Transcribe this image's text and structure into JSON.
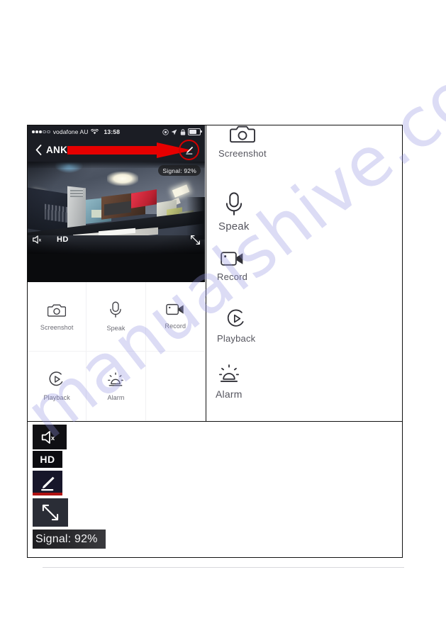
{
  "document": {
    "watermark": "manualshive.com"
  },
  "phone": {
    "status_bar": {
      "carrier": "vodafone AU",
      "time": "13:58",
      "wifi_icon": "wifi-icon",
      "location_icon": "location-arrow-icon",
      "orientation_lock_icon": "rotation-lock-icon",
      "battery_icon": "battery-icon",
      "signal_dots_icon": "signal-dots-icon"
    },
    "nav_bar": {
      "back_icon": "chevron-left-icon",
      "title": "ANKO",
      "edit_icon": "pencil-edit-icon",
      "annotation_icon": "red-arrow-icon",
      "highlight_color": "#d40000"
    },
    "video": {
      "signal_badge": "Signal: 92%",
      "mute_icon": "speaker-mute-icon",
      "quality_label": "HD",
      "fullscreen_icon": "fullscreen-expand-icon"
    },
    "buttons": [
      {
        "label": "Screenshot",
        "icon": "camera-icon"
      },
      {
        "label": "Speak",
        "icon": "microphone-icon"
      },
      {
        "label": "Record",
        "icon": "video-camera-icon"
      },
      {
        "label": "Playback",
        "icon": "play-circle-icon"
      },
      {
        "label": "Alarm",
        "icon": "alarm-siren-icon"
      }
    ]
  },
  "enlarged_icons": [
    {
      "label": "Screenshot",
      "icon": "camera-icon"
    },
    {
      "label": "Speak",
      "icon": "microphone-icon"
    },
    {
      "label": "Record",
      "icon": "video-camera-icon"
    },
    {
      "label": "Playback",
      "icon": "play-circle-icon"
    },
    {
      "label": "Alarm",
      "icon": "alarm-siren-icon"
    }
  ],
  "legend": {
    "mute_icon": "speaker-mute-icon",
    "hd_label": "HD",
    "edit_icon": "pencil-edit-icon",
    "fullscreen_icon": "fullscreen-expand-icon",
    "signal_label": "Signal: 92%"
  }
}
